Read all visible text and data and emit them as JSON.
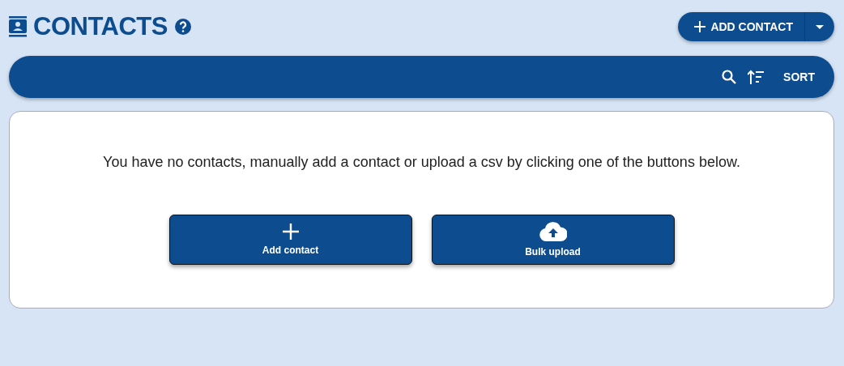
{
  "header": {
    "title": "CONTACTS",
    "add_button": "ADD CONTACT"
  },
  "toolbar": {
    "sort_label": "SORT"
  },
  "empty_state": {
    "message": "You have no contacts, manually add a contact or upload a csv by clicking one of the buttons below.",
    "buttons": [
      {
        "kind": "add",
        "label": "Add contact"
      },
      {
        "kind": "upload",
        "label": "Bulk upload"
      }
    ]
  }
}
